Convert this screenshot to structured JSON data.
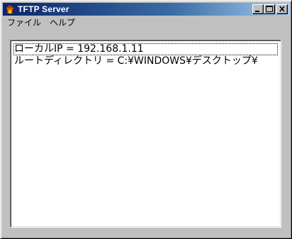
{
  "window": {
    "title": "TFTP Server"
  },
  "menu": {
    "items": [
      "ファイル",
      "ヘルプ"
    ]
  },
  "log": {
    "lines": [
      "ローカルIP = 192.168.1.11",
      "ルートディレクトリ = C:¥WINDOWS¥デスクトップ¥"
    ]
  }
}
